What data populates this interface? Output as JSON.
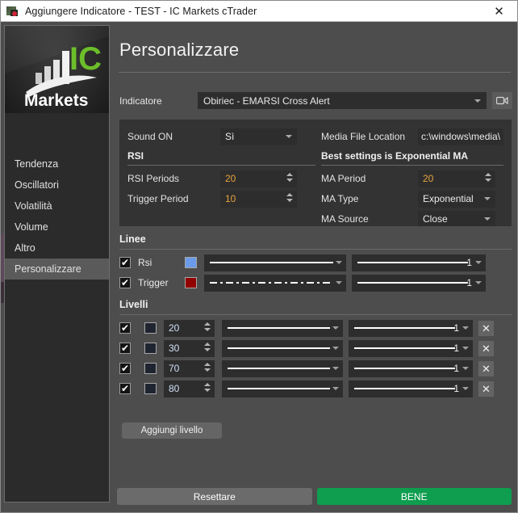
{
  "window": {
    "title": "Aggiungere Indicatore - TEST - IC Markets cTrader",
    "close_label": "✕",
    "app_icon": "ctrader-app-icon"
  },
  "sidebar": {
    "logo": {
      "brand_top": "IC",
      "brand_bottom": "Markets",
      "green": "#6cbe2a"
    },
    "items": [
      {
        "label": "Tendenza",
        "active": false
      },
      {
        "label": "Oscillatori",
        "active": false
      },
      {
        "label": "Volatilità",
        "active": false
      },
      {
        "label": "Volume",
        "active": false
      },
      {
        "label": "Altro",
        "active": false
      },
      {
        "label": "Personalizzare",
        "active": true
      }
    ]
  },
  "content": {
    "page_title": "Personalizzare",
    "indicator": {
      "label": "Indicatore",
      "value": "Obiriec - EMARSI Cross Alert",
      "camera_icon": "video-camera-icon"
    }
  },
  "settings": {
    "left": {
      "sound_on": {
        "label": "Sound ON",
        "value": "Sì"
      },
      "group_title": "RSI",
      "rsi_periods": {
        "label": "RSI Periods",
        "value": "20"
      },
      "trigger_period": {
        "label": "Trigger Period",
        "value": "10"
      }
    },
    "right": {
      "media_file": {
        "label": "Media File Location",
        "value": "c:\\windows\\media\\"
      },
      "group_title": "Best settings is Exponential MA",
      "ma_period": {
        "label": "MA Period",
        "value": "20"
      },
      "ma_type": {
        "label": "MA Type",
        "value": "Exponential"
      },
      "ma_source": {
        "label": "MA Source",
        "value": "Close"
      }
    }
  },
  "lines": {
    "title": "Linee",
    "rows": [
      {
        "checked": true,
        "check_glyph": "✔",
        "name": "Rsi",
        "color": "#6b9ae8",
        "style": "solid",
        "thickness": "1"
      },
      {
        "checked": true,
        "check_glyph": "✔",
        "name": "Trigger",
        "color": "#930000",
        "style": "dash-dot",
        "thickness": "1"
      }
    ]
  },
  "levels": {
    "title": "Livelli",
    "rows": [
      {
        "checked": true,
        "check_glyph": "✔",
        "color": "#1e2430",
        "value": "20",
        "style": "solid",
        "thickness": "1",
        "delete_glyph": "✕"
      },
      {
        "checked": true,
        "check_glyph": "✔",
        "color": "#1e2430",
        "value": "30",
        "style": "solid",
        "thickness": "1",
        "delete_glyph": "✕"
      },
      {
        "checked": true,
        "check_glyph": "✔",
        "color": "#1e2430",
        "value": "70",
        "style": "solid",
        "thickness": "1",
        "delete_glyph": "✕"
      },
      {
        "checked": true,
        "check_glyph": "✔",
        "color": "#1e2430",
        "value": "80",
        "style": "solid",
        "thickness": "1",
        "delete_glyph": "✕"
      }
    ],
    "add_button": "Aggiungi livello"
  },
  "footer": {
    "reset_label": "Resettare",
    "ok_label": "BENE",
    "ok_color": "#0f9d4f"
  }
}
